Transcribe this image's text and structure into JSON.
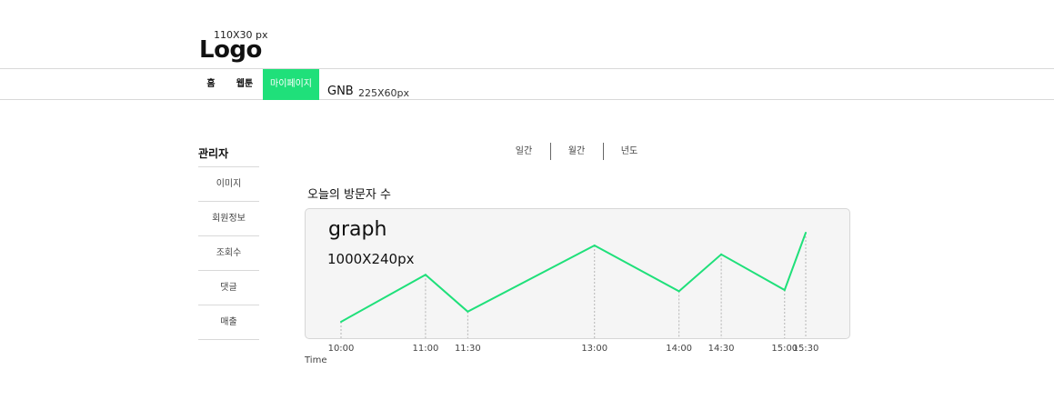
{
  "header": {
    "logo_size": "110X30 px",
    "logo_text": "Logo"
  },
  "gnb": {
    "items": [
      {
        "label": "홈"
      },
      {
        "label": "웹툰"
      },
      {
        "label": "마이페이지"
      }
    ],
    "active_index": 2,
    "note": "GNB",
    "note_size": "225X60px"
  },
  "sidebar": {
    "title": "관리자",
    "items": [
      {
        "label": "이미지"
      },
      {
        "label": "회원정보"
      },
      {
        "label": "조회수"
      },
      {
        "label": "댓글"
      },
      {
        "label": "매출"
      }
    ]
  },
  "period_tabs": [
    "일간",
    "월간",
    "년도"
  ],
  "chart": {
    "title": "오늘의 방문자 수",
    "placeholder_title": "graph",
    "placeholder_size": "1000X240px"
  },
  "colors": {
    "accent": "#1fe07a",
    "line": "#1fe07a"
  },
  "chart_data": {
    "type": "line",
    "x": [
      "10:00",
      "11:00",
      "11:30",
      "13:00",
      "14:00",
      "14:30",
      "15:00",
      "15:30"
    ],
    "x_minutes": [
      600,
      660,
      690,
      780,
      840,
      870,
      915,
      930
    ],
    "values": [
      10,
      47,
      18,
      70,
      34,
      63,
      35,
      80
    ],
    "xlabel": "Time",
    "ylim": [
      0,
      100
    ],
    "grid": "vertical dashed at points",
    "legend": "none"
  }
}
